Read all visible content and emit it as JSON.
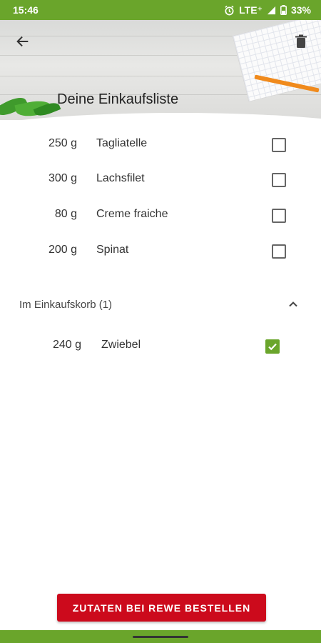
{
  "status_bar": {
    "time": "15:46",
    "network": "LTE⁺",
    "battery": "33%",
    "icons": [
      "alarm-icon",
      "signal-icon",
      "battery-icon"
    ]
  },
  "header": {
    "title": "Deine Einkaufsliste",
    "back_icon": "arrow-left-icon",
    "trash_icon": "trash-icon"
  },
  "items": [
    {
      "qty": "250 g",
      "name": "Tagliatelle",
      "checked": false
    },
    {
      "qty": "300 g",
      "name": "Lachsfilet",
      "checked": false
    },
    {
      "qty": "80 g",
      "name": "Creme fraiche",
      "checked": false
    },
    {
      "qty": "200 g",
      "name": "Spinat",
      "checked": false
    }
  ],
  "basket": {
    "label": "Im Einkaufskorb (1)",
    "expanded": true,
    "items": [
      {
        "qty": "240 g",
        "name": "Zwiebel",
        "checked": true
      }
    ]
  },
  "order_button": {
    "label": "ZUTATEN BEI REWE BESTELLEN"
  },
  "colors": {
    "accent_green": "#6aa52b",
    "rewe_red": "#cc0a1c"
  }
}
